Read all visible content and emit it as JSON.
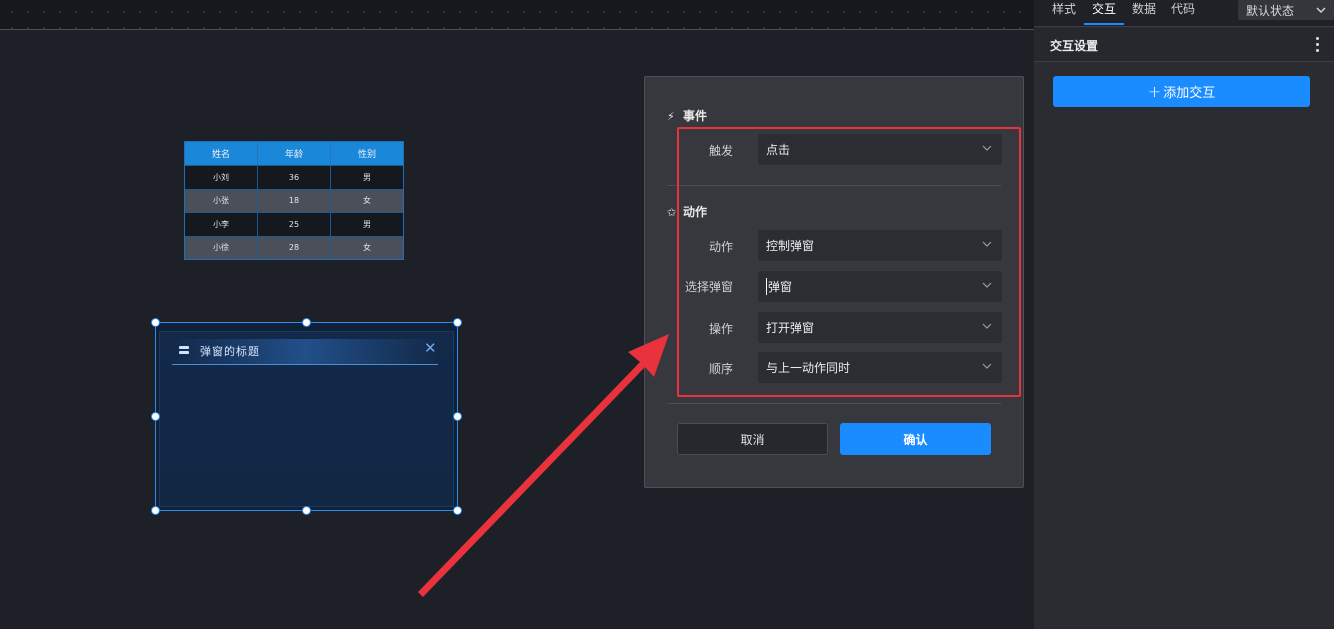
{
  "canvas": {
    "table": {
      "headers": [
        "姓名",
        "年龄",
        "性别"
      ],
      "rows": [
        [
          "小刘",
          "36",
          "男"
        ],
        [
          "小张",
          "18",
          "女"
        ],
        [
          "小李",
          "25",
          "男"
        ],
        [
          "小徐",
          "28",
          "女"
        ]
      ]
    },
    "popup": {
      "title": "弹窗的标题",
      "close_icon": "close-icon",
      "title_icon": "list-icon"
    }
  },
  "modal": {
    "event_section": {
      "title": "事件",
      "icon": "lightning-icon"
    },
    "trigger": {
      "label": "触发",
      "value": "点击"
    },
    "action_section": {
      "title": "动作",
      "icon": "star-icon"
    },
    "action": {
      "label": "动作",
      "value": "控制弹窗"
    },
    "select_popup": {
      "label": "选择弹窗",
      "value": "弹窗"
    },
    "operation": {
      "label": "操作",
      "value": "打开弹窗"
    },
    "order": {
      "label": "顺序",
      "value": "与上一动作同时"
    },
    "cancel_label": "取消",
    "confirm_label": "确认",
    "highlight_color": "#e8323c"
  },
  "right_panel": {
    "tabs": [
      "样式",
      "交互",
      "数据",
      "代码"
    ],
    "active_tab": "交互",
    "state_dropdown": "默认状态",
    "section_title": "交互设置",
    "add_button": "添加交互",
    "accent_color": "#1a8cff"
  }
}
